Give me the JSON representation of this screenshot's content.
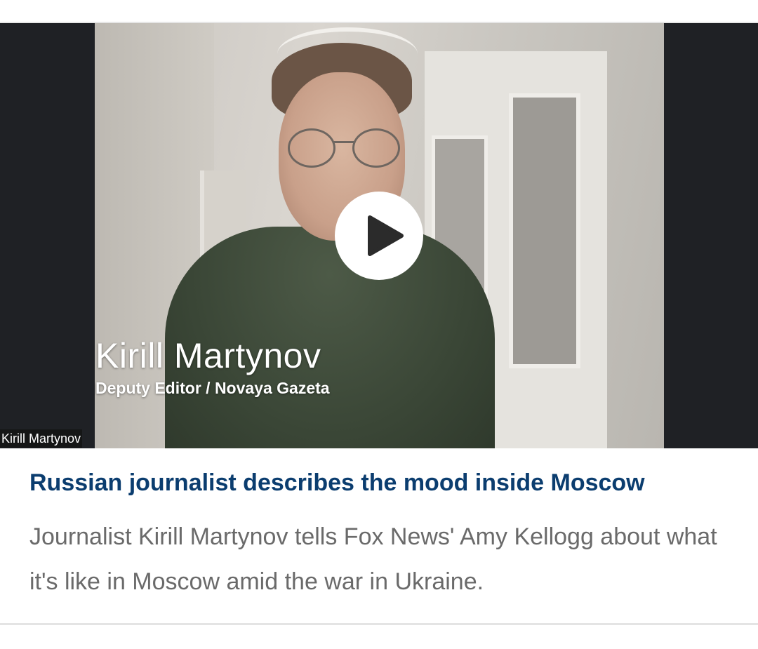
{
  "video": {
    "lower_third_name": "Kirill Martynov",
    "lower_third_role": "Deputy Editor / Novaya Gazeta",
    "participant_tag": "Kirill Martynov",
    "play_icon": "play-icon"
  },
  "article": {
    "headline": "Russian journalist describes the mood inside Moscow",
    "summary": "Journalist Kirill Martynov tells Fox News' Amy Kellogg about what it's like in Moscow amid the war in Ukraine."
  },
  "colors": {
    "headline": "#0b3d6f",
    "summary": "#6a6a6a",
    "letterbox": "#1f2125"
  }
}
